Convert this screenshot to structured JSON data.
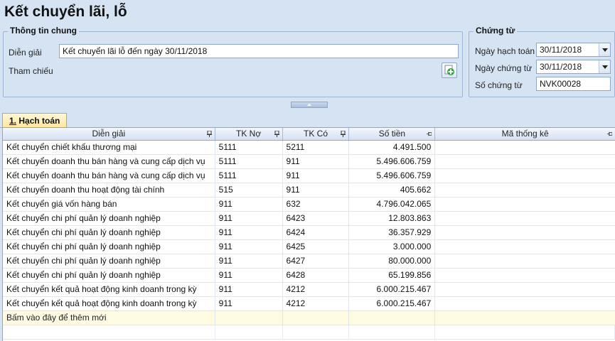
{
  "page": {
    "title": "Kết chuyển lãi, lỗ"
  },
  "general": {
    "legend": "Thông tin chung",
    "desc_label": "Diễn giải",
    "desc_value": "Kết chuyển lãi lỗ đến ngày 30/11/2018",
    "ref_label": "Tham chiếu",
    "ref_button_icon": "add-reference-icon"
  },
  "voucher": {
    "legend": "Chứng từ",
    "posting_date_label": "Ngày hạch toán",
    "posting_date": "30/11/2018",
    "voucher_date_label": "Ngày chứng từ",
    "voucher_date": "30/11/2018",
    "voucher_no_label": "Số chứng từ",
    "voucher_no": "NVK00028"
  },
  "tab": {
    "number": "1.",
    "label": " Hạch toán"
  },
  "grid": {
    "columns": [
      "Diễn giải",
      "TK Nợ",
      "TK Có",
      "Số tiền",
      "Mã thống kê"
    ],
    "rows": [
      {
        "desc": "Kết chuyển chiết khấu thương mại",
        "debit": "5111",
        "credit": "5211",
        "amount": "4.491.500",
        "code": ""
      },
      {
        "desc": "Kết chuyển doanh thu bán hàng và cung cấp dịch vụ",
        "debit": "5111",
        "credit": "911",
        "amount": "5.496.606.759",
        "code": ""
      },
      {
        "desc": "Kết chuyển doanh thu bán hàng và cung cấp dịch vụ",
        "debit": "5111",
        "credit": "911",
        "amount": "5.496.606.759",
        "code": ""
      },
      {
        "desc": "Kết chuyển doanh thu hoạt động tài chính",
        "debit": "515",
        "credit": "911",
        "amount": "405.662",
        "code": ""
      },
      {
        "desc": "Kết chuyển giá vốn hàng bán",
        "debit": "911",
        "credit": "632",
        "amount": "4.796.042.065",
        "code": ""
      },
      {
        "desc": "Kết chuyển chi phí quản lý doanh nghiệp",
        "debit": "911",
        "credit": "6423",
        "amount": "12.803.863",
        "code": ""
      },
      {
        "desc": "Kết chuyển chi phí quản lý doanh nghiệp",
        "debit": "911",
        "credit": "6424",
        "amount": "36.357.929",
        "code": ""
      },
      {
        "desc": "Kết chuyển chi phí quản lý doanh nghiệp",
        "debit": "911",
        "credit": "6425",
        "amount": "3.000.000",
        "code": ""
      },
      {
        "desc": "Kết chuyển chi phí quản lý doanh nghiệp",
        "debit": "911",
        "credit": "6427",
        "amount": "80.000.000",
        "code": ""
      },
      {
        "desc": "Kết chuyển chi phí quản lý doanh nghiệp",
        "debit": "911",
        "credit": "6428",
        "amount": "65.199.856",
        "code": ""
      },
      {
        "desc": "Kết chuyển kết quả hoạt động kinh doanh trong kỳ",
        "debit": "911",
        "credit": "4212",
        "amount": "6.000.215.467",
        "code": ""
      },
      {
        "desc": "Kết chuyển kết quả hoạt động kinh doanh trong kỳ",
        "debit": "911",
        "credit": "4212",
        "amount": "6.000.215.467",
        "code": ""
      }
    ],
    "add_new": "Bấm vào đây để thêm mới"
  }
}
